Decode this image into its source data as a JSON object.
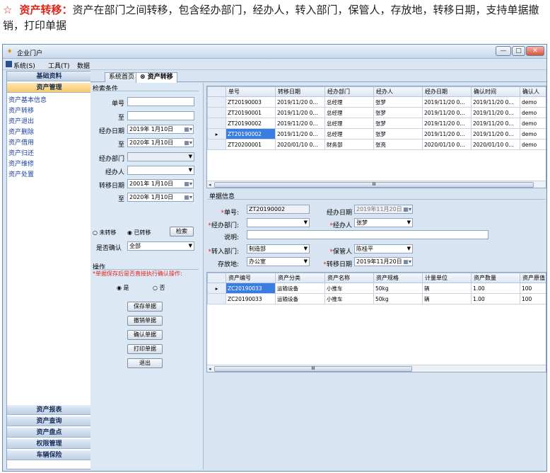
{
  "caption": {
    "star": "☆",
    "title": "资产转移：",
    "text": "资产在部门之间转移，包含经办部门，经办人，转入部门，保管人，存放地，转移日期，支持单据撤销，打印单据"
  },
  "window": {
    "title": "企业门户",
    "buttons": {
      "minimize": "—",
      "restore": "□",
      "close": "✕"
    }
  },
  "menu": [
    "系统(S)",
    "工具(T)",
    "数据"
  ],
  "sidebar": {
    "top_headers": [
      "基础资料",
      "资产管理"
    ],
    "items": [
      "资产基本信息",
      "资产转移",
      "资产退出",
      "资产删除",
      "资产借用",
      "资产归还",
      "资产维修",
      "资产处置"
    ],
    "bottom_headers": [
      "资产报表",
      "资产查询",
      "资产盘点",
      "权限管理",
      "车辆保险"
    ]
  },
  "tabs": {
    "home": "系统首页",
    "active": "资产转移",
    "close_icon": "⊗"
  },
  "search": {
    "group_title": "检索条件",
    "labels": {
      "doc_no": "单号",
      "to1": "至",
      "op_date": "经办日期",
      "to2": "至",
      "dept": "经办部门",
      "handler": "经办人",
      "transfer_date": "转移日期",
      "to3": "至",
      "confirm": "是否确认"
    },
    "values": {
      "doc_no": "",
      "doc_no_to": "",
      "op_date_from": "2019年 1月10日",
      "op_date_to": "2020年 1月10日",
      "dept": "",
      "handler": "",
      "transfer_from": "2001年 1月10日",
      "transfer_to": "2020年 1月10日",
      "confirm": "全部"
    },
    "radio_untransferred": "未转移",
    "radio_transferred": "已转移",
    "search_button": "检索"
  },
  "operations": {
    "group_title": "操作",
    "note": "*单据保存后是否直接执行确认操作:",
    "yes": "是",
    "no": "否",
    "buttons": [
      "保存单据",
      "撤销单据",
      "确认单据",
      "打印单据",
      "退出"
    ]
  },
  "main_grid": {
    "columns": [
      "单号",
      "转移日期",
      "经办部门",
      "经办人",
      "经办日期",
      "确认时间",
      "确认人"
    ],
    "rows": [
      [
        "ZT20190003",
        "2019/11/20 0...",
        "总经理",
        "张梦",
        "2019/11/20 0...",
        "2019/11/20 0...",
        "demo"
      ],
      [
        "ZT20190001",
        "2019/11/20 0...",
        "总经理",
        "张梦",
        "2019/11/20 0...",
        "2019/11/20 0...",
        "demo"
      ],
      [
        "ZT20190002",
        "2019/11/20 0...",
        "总经理",
        "张梦",
        "2019/11/20 0...",
        "2019/11/20 0...",
        "demo"
      ],
      [
        "ZT20190002",
        "2019/11/20 0...",
        "总经理",
        "张梦",
        "2019/11/20 0...",
        "2019/11/20 0...",
        "demo"
      ],
      [
        "ZT20200001",
        "2020/01/10 0...",
        "财务部",
        "张亮",
        "2020/01/10 0...",
        "2020/01/10 0...",
        "demo"
      ]
    ],
    "selected_row": 3,
    "scroll_thumb": "III"
  },
  "doc_info": {
    "group_title": "单据信息",
    "labels": {
      "doc_no": "单号:",
      "op_date": "经办日期",
      "op_dept": "经办部门:",
      "handler": "经办人",
      "note": "说明:",
      "in_dept": "转入部门:",
      "keeper": "保管人",
      "location": "存放地:",
      "transfer_date": "转移日期"
    },
    "values": {
      "doc_no": "ZT20190002",
      "op_date": "2019年11月20日",
      "op_dept": "",
      "handler": "张梦",
      "note": "",
      "in_dept": "制造部",
      "keeper": "陈桂平",
      "location": "办公室",
      "transfer_date": "2019年11月20日"
    }
  },
  "asset_grid": {
    "columns": [
      "资产编号",
      "资产分类",
      "资产名称",
      "资产规格",
      "计量单位",
      "资产数量",
      "资产原值"
    ],
    "rows": [
      [
        "ZC20190033",
        "运输设备",
        "小推车",
        "50kg",
        "辆",
        "1.00",
        "100"
      ],
      [
        "ZC20190033",
        "运输设备",
        "小推车",
        "50kg",
        "辆",
        "1.00",
        "100"
      ]
    ],
    "selected_row": 0,
    "scroll_thumb": "III"
  },
  "colors": {
    "accent_red": "#e0261a",
    "selection": "#3a7ce0",
    "nav_link": "#1b3f9b"
  }
}
